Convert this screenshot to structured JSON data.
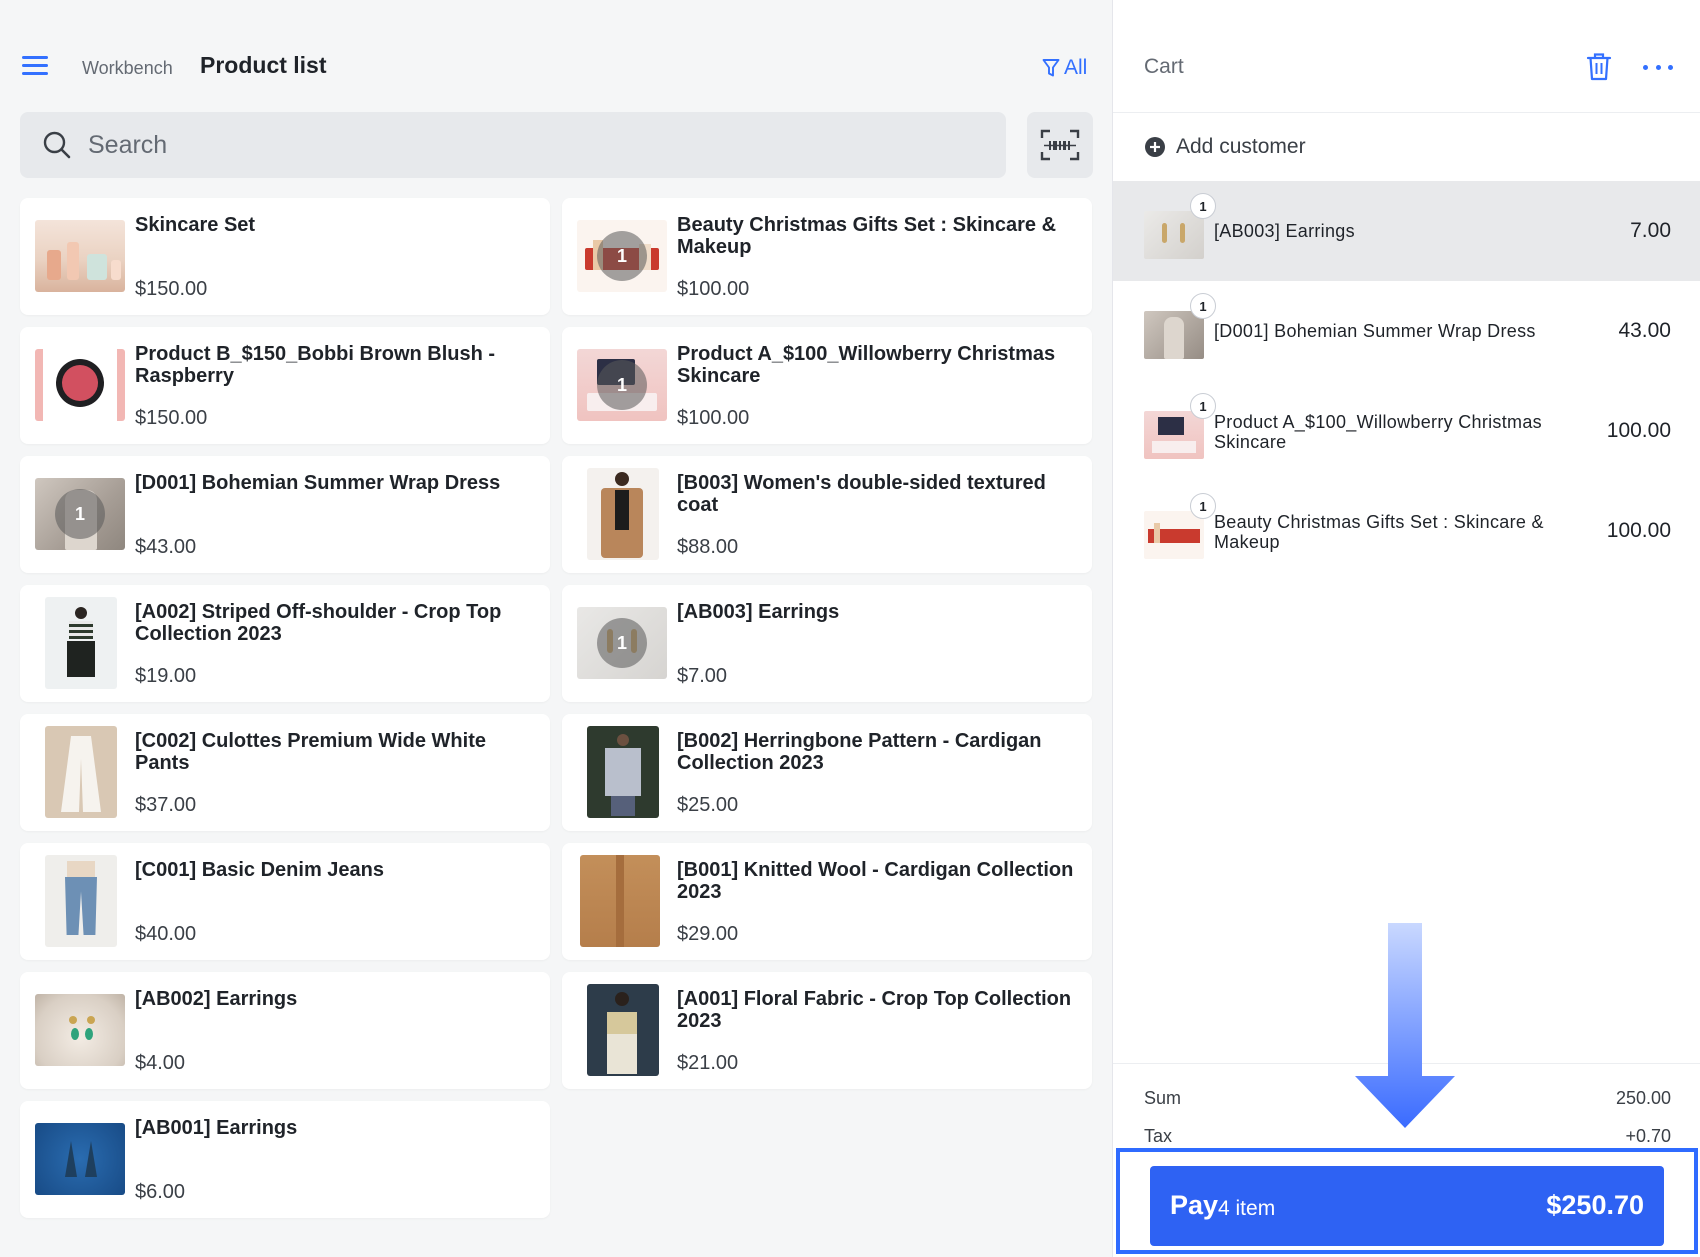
{
  "header": {
    "breadcrumb": "Workbench",
    "title": "Product list",
    "filter_label": "All",
    "menu_icon": "hamburger-menu-icon",
    "filter_icon": "funnel-icon"
  },
  "search": {
    "placeholder": "Search",
    "value": "",
    "icon": "search-icon",
    "scan_icon": "barcode-scan-icon"
  },
  "products": [
    {
      "name": "Skincare Set",
      "price": "$150.00",
      "qty": ""
    },
    {
      "name": "Beauty Christmas Gifts Set : Skincare & Makeup",
      "price": "$100.00",
      "qty": "1"
    },
    {
      "name": "Product B_$150_Bobbi Brown Blush - Raspberry",
      "price": "$150.00",
      "qty": ""
    },
    {
      "name": "Product A_$100_Willowberry Christmas Skincare",
      "price": "$100.00",
      "qty": "1"
    },
    {
      "name": "[D001] Bohemian Summer Wrap Dress",
      "price": "$43.00",
      "qty": "1"
    },
    {
      "name": "[B003] Women's double-sided textured coat",
      "price": "$88.00",
      "qty": ""
    },
    {
      "name": "[A002] Striped Off-shoulder - Crop Top Collection 2023",
      "price": "$19.00",
      "qty": ""
    },
    {
      "name": "[AB003] Earrings",
      "price": "$7.00",
      "qty": "1"
    },
    {
      "name": "[C002] Culottes Premium Wide White Pants",
      "price": "$37.00",
      "qty": ""
    },
    {
      "name": "[B002] Herringbone Pattern - Cardigan Collection 2023",
      "price": "$25.00",
      "qty": ""
    },
    {
      "name": "[C001] Basic Denim Jeans",
      "price": "$40.00",
      "qty": ""
    },
    {
      "name": "[B001] Knitted Wool - Cardigan Collection 2023",
      "price": "$29.00",
      "qty": ""
    },
    {
      "name": "[AB002] Earrings",
      "price": "$4.00",
      "qty": ""
    },
    {
      "name": "[A001] Floral Fabric - Crop Top Collection 2023",
      "price": "$21.00",
      "qty": ""
    },
    {
      "name": "[AB001] Earrings",
      "price": "$6.00",
      "qty": ""
    }
  ],
  "cart": {
    "title": "Cart",
    "trash_icon": "trash-icon",
    "more_icon": "more-dots-icon",
    "add_customer": "Add customer",
    "add_customer_icon": "plus-circle-icon",
    "items": [
      {
        "qty": "1",
        "name": "[AB003] Earrings",
        "price": "7.00",
        "selected": true
      },
      {
        "qty": "1",
        "name": "[D001] Bohemian Summer Wrap Dress",
        "price": "43.00",
        "selected": false
      },
      {
        "qty": "1",
        "name": "Product A_$100_Willowberry Christmas Skincare",
        "price": "100.00",
        "selected": false
      },
      {
        "qty": "1",
        "name": "Beauty Christmas Gifts Set : Skincare & Makeup",
        "price": "100.00",
        "selected": false
      }
    ],
    "sum_label": "Sum",
    "sum_value": "250.00",
    "tax_label": "Tax",
    "tax_value": "+0.70",
    "pay": {
      "label": "Pay",
      "count": "4 item",
      "total": "$250.70"
    }
  },
  "colors": {
    "accent": "#3370ff",
    "pay_button": "#2e62f3",
    "highlight_frame": "#2f6bff"
  },
  "annotation": {
    "arrow_icon": "down-arrow-annotation"
  }
}
